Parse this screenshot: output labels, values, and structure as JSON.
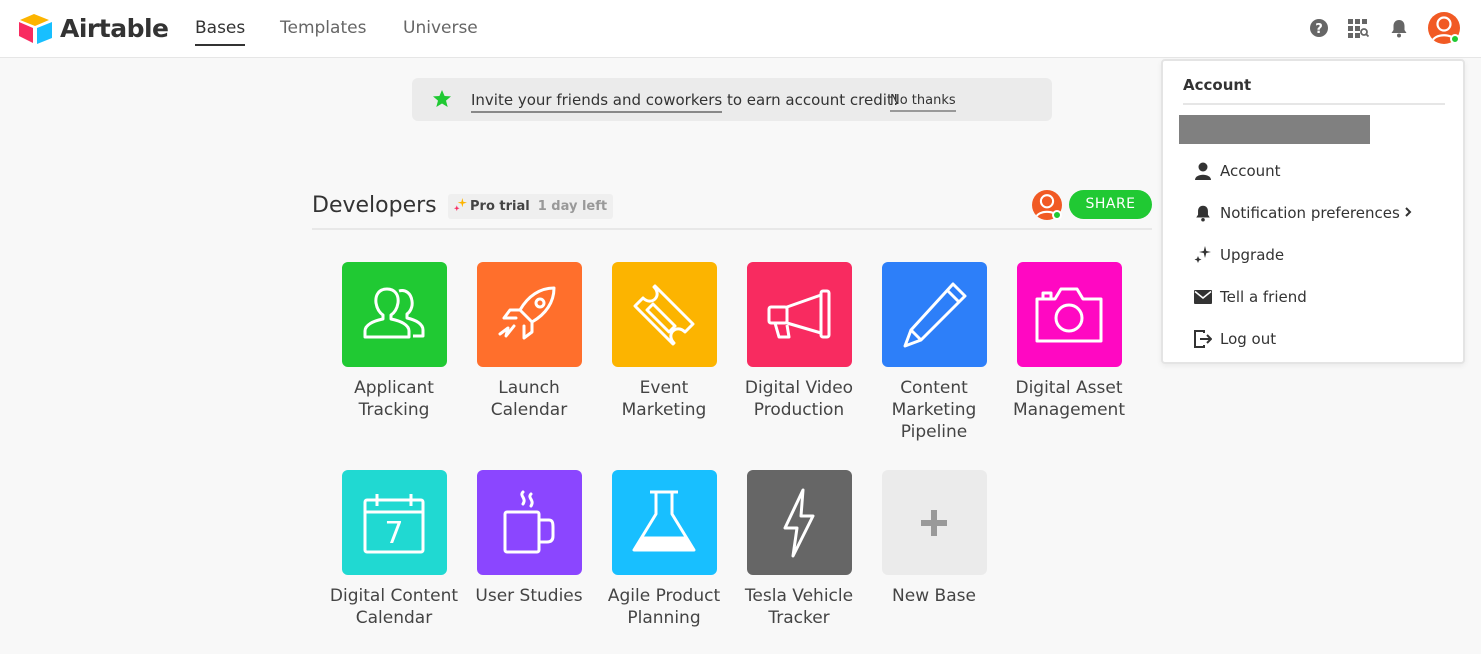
{
  "header": {
    "logo_text": "Airtable",
    "tabs": [
      {
        "label": "Bases",
        "active": true
      },
      {
        "label": "Templates",
        "active": false
      },
      {
        "label": "Universe",
        "active": false
      }
    ],
    "icons": [
      "help-icon",
      "apps-grid-icon",
      "bell-icon",
      "user-avatar"
    ]
  },
  "banner": {
    "icon": "star-icon",
    "link_text": "Invite your friends and coworkers",
    "rest_text": " to earn account credit!",
    "dismiss_label": "No thanks"
  },
  "workspace": {
    "title": "Developers",
    "badge_label": "Pro trial",
    "badge_remaining": "1 day left",
    "share_label": "SHARE"
  },
  "bases": [
    {
      "name": "Applicant Tracking",
      "color": "#20c933",
      "icon": "users-icon"
    },
    {
      "name": "Launch Calendar",
      "color": "#ff6f2c",
      "icon": "rocket-icon"
    },
    {
      "name": "Event Marketing",
      "color": "#fcb400",
      "icon": "ticket-icon"
    },
    {
      "name": "Digital Video Production",
      "color": "#f82b60",
      "icon": "megaphone-icon"
    },
    {
      "name": "Content Marketing Pipeline",
      "color": "#2d7ff9",
      "icon": "pencil-icon"
    },
    {
      "name": "Digital Asset Management",
      "color": "#ff08c2",
      "icon": "camera-icon"
    },
    {
      "name": "Digital Content Calendar",
      "color": "#20d9d2",
      "icon": "calendar-icon",
      "calendar_day": "7"
    },
    {
      "name": "User Studies",
      "color": "#8b46ff",
      "icon": "mug-icon"
    },
    {
      "name": "Agile Product Planning",
      "color": "#18bfff",
      "icon": "flask-icon"
    },
    {
      "name": "Tesla Vehicle Tracker",
      "color": "#666666",
      "icon": "lightning-icon"
    },
    {
      "name": "New Base",
      "color": "#ebebeb",
      "icon": "plus-icon"
    }
  ],
  "account_menu": {
    "header": "Account",
    "items": [
      {
        "label": "Account",
        "icon": "person-icon"
      },
      {
        "label": "Notification preferences",
        "icon": "bell-icon",
        "has_submenu": true
      },
      {
        "label": "Upgrade",
        "icon": "sparkle-icon"
      },
      {
        "label": "Tell a friend",
        "icon": "envelope-icon"
      },
      {
        "label": "Log out",
        "icon": "logout-icon"
      }
    ]
  },
  "colors": {
    "green": "#20c933",
    "avatar_orange": "#f15a24"
  }
}
